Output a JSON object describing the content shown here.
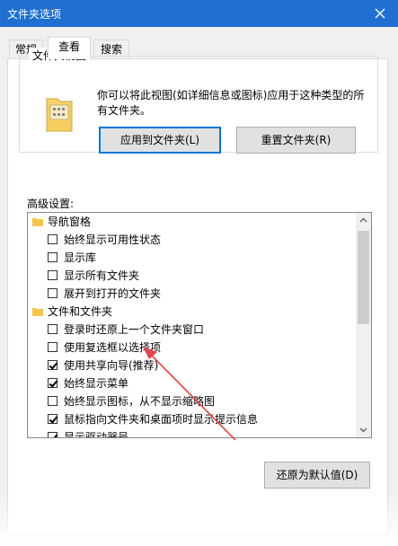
{
  "window": {
    "title": "文件夹选项"
  },
  "tabs": [
    {
      "label": "常规",
      "active": false
    },
    {
      "label": "查看",
      "active": true
    },
    {
      "label": "搜索",
      "active": false
    }
  ],
  "folder_view": {
    "legend": "文件夹视图",
    "description": "你可以将此视图(如详细信息或图标)应用于这种类型的所有文件夹。",
    "apply_button": "应用到文件夹(L)",
    "reset_button": "重置文件夹(R)"
  },
  "advanced": {
    "label": "高级设置:",
    "items": [
      {
        "label": "导航窗格",
        "kind": "group"
      },
      {
        "label": "始终显示可用性状态",
        "kind": "checkbox",
        "checked": false
      },
      {
        "label": "显示库",
        "kind": "checkbox",
        "checked": false
      },
      {
        "label": "显示所有文件夹",
        "kind": "checkbox",
        "checked": false
      },
      {
        "label": "展开到打开的文件夹",
        "kind": "checkbox",
        "checked": false
      },
      {
        "label": "文件和文件夹",
        "kind": "group"
      },
      {
        "label": "登录时还原上一个文件夹窗口",
        "kind": "checkbox",
        "checked": false
      },
      {
        "label": "使用复选框以选择项",
        "kind": "checkbox",
        "checked": false
      },
      {
        "label": "使用共享向导(推荐)",
        "kind": "checkbox",
        "checked": true
      },
      {
        "label": "始终显示菜单",
        "kind": "checkbox",
        "checked": true
      },
      {
        "label": "始终显示图标，从不显示缩略图",
        "kind": "checkbox",
        "checked": false
      },
      {
        "label": "鼠标指向文件夹和桌面项时显示提示信息",
        "kind": "checkbox",
        "checked": true
      },
      {
        "label": "显示驱动器号",
        "kind": "checkbox",
        "checked": true
      }
    ]
  },
  "restore_button": "还原为默认值(D)",
  "colors": {
    "titlebar": "#1e6fd0",
    "annotation_arrow": "#e0474c"
  }
}
